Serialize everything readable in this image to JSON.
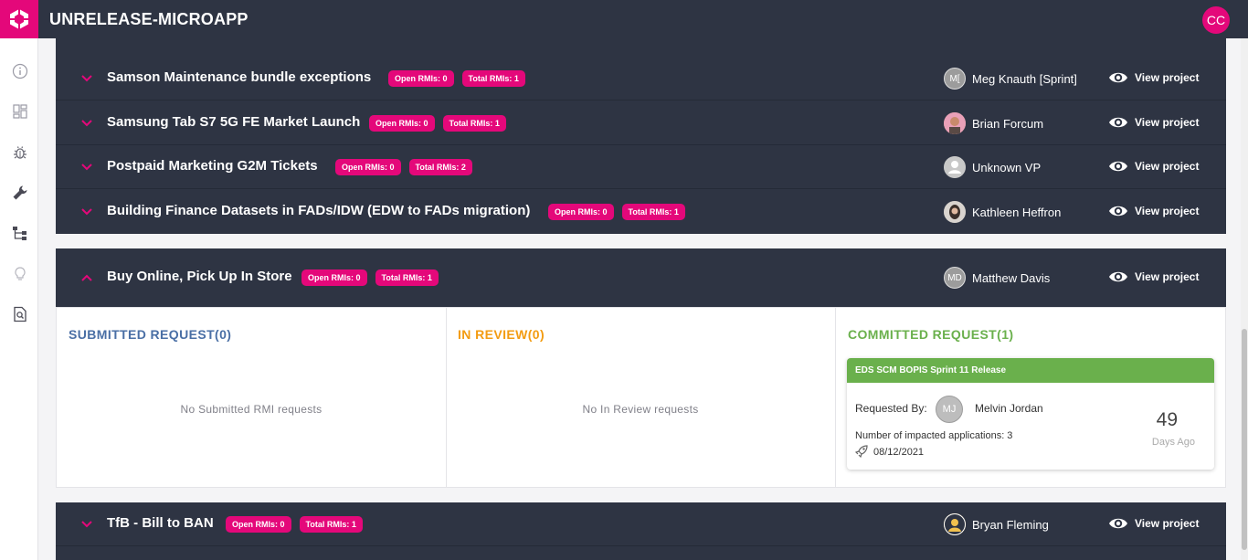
{
  "app": {
    "title": "UNRELEASE-MICROAPP",
    "user_initials": "CC"
  },
  "colors": {
    "brand": "#e4087a",
    "header_bg": "#2e3443",
    "submitted": "#4a6fa5",
    "in_review": "#f39c12",
    "committed": "#6ab04c"
  },
  "sidebar": {
    "items": [
      {
        "icon": "info-icon"
      },
      {
        "icon": "dashboard-icon"
      },
      {
        "icon": "bug-icon"
      },
      {
        "icon": "wrench-icon"
      },
      {
        "icon": "hierarchy-icon"
      },
      {
        "icon": "lightbulb-icon"
      },
      {
        "icon": "document-search-icon"
      }
    ]
  },
  "projects_top": [
    {
      "name": "Samson Maintenance bundle exceptions",
      "open": "Open RMIs: 0",
      "total": "Total RMIs: 1",
      "owner": "Meg Knauth [Sprint]",
      "owner_initials": "M[",
      "view": "View project"
    },
    {
      "name": "Samsung Tab S7 5G FE Market Launch",
      "open": "Open RMIs: 0",
      "total": "Total RMIs: 1",
      "owner": "Brian Forcum",
      "owner_initials": "",
      "view": "View project"
    },
    {
      "name": "Postpaid Marketing G2M Tickets",
      "open": "Open RMIs: 0",
      "total": "Total RMIs: 2",
      "owner": "Unknown VP",
      "owner_initials": "",
      "view": "View project"
    },
    {
      "name": "Building Finance Datasets in FADs/IDW (EDW to FADs migration)",
      "open": "Open RMIs: 0",
      "total": "Total RMIs: 1",
      "owner": "Kathleen Heffron",
      "owner_initials": "",
      "view": "View project"
    }
  ],
  "expanded_project": {
    "name": "Buy Online, Pick Up In Store",
    "open": "Open RMIs: 0",
    "total": "Total RMIs: 1",
    "owner": "Matthew Davis",
    "owner_initials": "MD",
    "view": "View project",
    "columns": {
      "submitted": {
        "title": "SUBMITTED REQUEST(0)",
        "empty": "No Submitted RMI requests"
      },
      "in_review": {
        "title": "IN REVIEW(0)",
        "empty": "No In Review requests"
      },
      "committed": {
        "title": "COMMITTED REQUEST(1)"
      }
    },
    "card": {
      "title": "EDS SCM BOPIS Sprint 11 Release",
      "requested_by_label": "Requested By:",
      "requester_initials": "MJ",
      "requester_name": "Melvin Jordan",
      "impacted": "Number of impacted applications: 3",
      "date": "08/12/2021",
      "days": "49",
      "days_label": "Days Ago"
    }
  },
  "projects_bottom": [
    {
      "name": "TfB - Bill to BAN",
      "open": "Open RMIs: 0",
      "total": "Total RMIs: 1",
      "owner": "Bryan Fleming",
      "owner_initials": "",
      "view": "View project"
    }
  ]
}
